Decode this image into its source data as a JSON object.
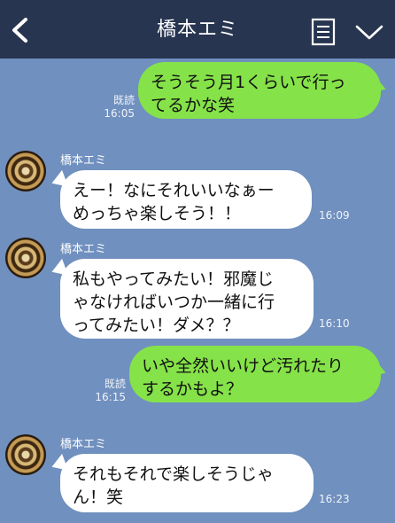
{
  "header": {
    "title": "橋本エミ"
  },
  "colors": {
    "header_bg": "#283551",
    "chat_bg": "#7090bf",
    "outgoing_bubble": "#85e249",
    "incoming_bubble": "#ffffff"
  },
  "messages": [
    {
      "direction": "out",
      "text": "そうそう月1くらいで行っ\nてるかな笑",
      "read_label": "既読",
      "time": "16:05"
    },
    {
      "direction": "in",
      "sender": "橋本エミ",
      "text": "えー！なにそれいいなぁー\nめっちゃ楽しそう！！",
      "time": "16:09"
    },
    {
      "direction": "in",
      "sender": "橋本エミ",
      "text": "私もやってみたい！邪魔じ\nゃなければいつか一緒に行\nってみたい！ダメ？？",
      "time": "16:10"
    },
    {
      "direction": "out",
      "text": "いや全然いいけど汚れたり\nするかもよ？",
      "read_label": "既読",
      "time": "16:15"
    },
    {
      "direction": "in",
      "sender": "橋本エミ",
      "text": "それもそれで楽しそうじゃ\nん！笑",
      "time": "16:23"
    }
  ]
}
